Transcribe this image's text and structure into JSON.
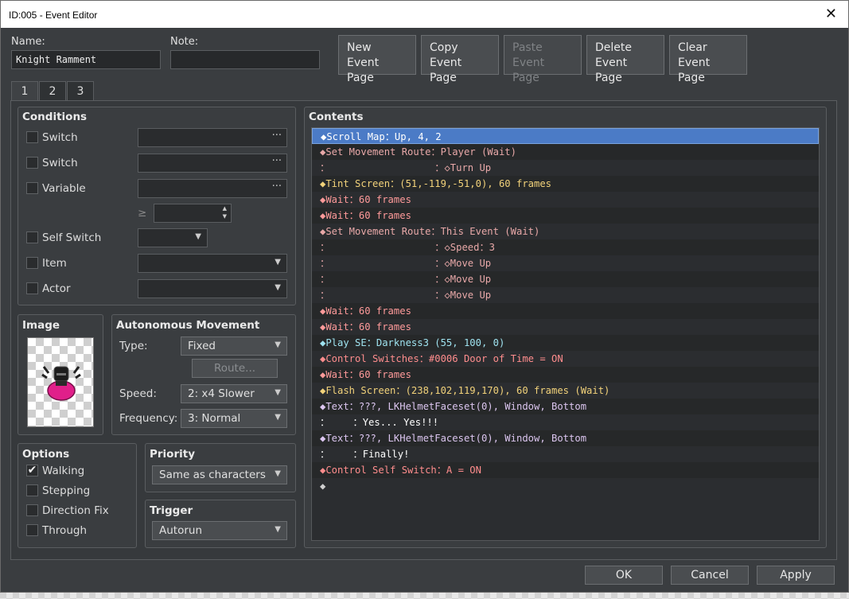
{
  "window": {
    "title": "ID:005 - Event Editor",
    "close_glyph": "✕"
  },
  "name": {
    "label": "Name:",
    "value": "Knight Ramment"
  },
  "note": {
    "label": "Note:",
    "value": ""
  },
  "page_buttons": [
    {
      "line1": "New",
      "line2": "Event Page",
      "enabled": true
    },
    {
      "line1": "Copy",
      "line2": "Event Page",
      "enabled": true
    },
    {
      "line1": "Paste",
      "line2": "Event Page",
      "enabled": false
    },
    {
      "line1": "Delete",
      "line2": "Event Page",
      "enabled": true
    },
    {
      "line1": "Clear",
      "line2": "Event Page",
      "enabled": true
    }
  ],
  "tabs": [
    "1",
    "2",
    "3"
  ],
  "conditions": {
    "title": "Conditions",
    "switch1": "Switch",
    "switch2": "Switch",
    "variable": "Variable",
    "ge_symbol": "≥",
    "self_switch": "Self Switch",
    "item": "Item",
    "actor": "Actor",
    "dots": "···"
  },
  "image": {
    "title": "Image"
  },
  "autonomous": {
    "title": "Autonomous Movement",
    "type_label": "Type:",
    "type_value": "Fixed",
    "route_label": "Route...",
    "speed_label": "Speed:",
    "speed_value": "2: x4 Slower",
    "frequency_label": "Frequency:",
    "frequency_value": "3: Normal"
  },
  "options": {
    "title": "Options",
    "walking": "Walking",
    "stepping": "Stepping",
    "direction_fix": "Direction Fix",
    "through": "Through",
    "check_glyph": "✔"
  },
  "priority": {
    "title": "Priority",
    "value": "Same as characters"
  },
  "trigger": {
    "title": "Trigger",
    "value": "Autorun"
  },
  "contents": {
    "title": "Contents",
    "rows": [
      {
        "text": "◆Scroll Map：Up, 4, 2",
        "cls": "c-scroll"
      },
      {
        "text": "◆Set Movement Route：Player (Wait)",
        "cls": "c-move"
      },
      {
        "text": "：                  ：◇Turn Up",
        "cls": "c-move"
      },
      {
        "text": "◆Tint Screen：(51,-119,-51,0), 60 frames",
        "cls": "c-tint"
      },
      {
        "text": "◆Wait：60 frames",
        "cls": "c-wait"
      },
      {
        "text": "◆Wait：60 frames",
        "cls": "c-wait"
      },
      {
        "text": "◆Set Movement Route：This Event (Wait)",
        "cls": "c-move"
      },
      {
        "text": "：                  ：◇Speed：3",
        "cls": "c-move"
      },
      {
        "text": "：                  ：◇Move Up",
        "cls": "c-move"
      },
      {
        "text": "：                  ：◇Move Up",
        "cls": "c-move"
      },
      {
        "text": "：                  ：◇Move Up",
        "cls": "c-move"
      },
      {
        "text": "◆Wait：60 frames",
        "cls": "c-wait"
      },
      {
        "text": "◆Wait：60 frames",
        "cls": "c-wait"
      },
      {
        "text": "◆Play SE：Darkness3 (55, 100, 0)",
        "cls": "c-se"
      },
      {
        "text": "◆Control Switches：#0006 Door of Time = ON",
        "cls": "c-sw"
      },
      {
        "text": "◆Wait：60 frames",
        "cls": "c-wait"
      },
      {
        "text": "◆Flash Screen：(238,102,119,170), 60 frames (Wait)",
        "cls": "c-tint"
      },
      {
        "text": "◆Text：???, LKHelmetFaceset(0), Window, Bottom",
        "cls": "c-text"
      },
      {
        "text": "：    ：Yes... Yes!!!",
        "cls": "c-bright"
      },
      {
        "text": "◆Text：???, LKHelmetFaceset(0), Window, Bottom",
        "cls": "c-text"
      },
      {
        "text": "：    ：Finally!",
        "cls": "c-bright"
      },
      {
        "text": "◆Control Self Switch：A = ON",
        "cls": "c-sw"
      },
      {
        "text": "◆",
        "cls": "c-grey"
      }
    ]
  },
  "footer": {
    "ok": "OK",
    "cancel": "Cancel",
    "apply": "Apply"
  },
  "colors": {
    "accent": "#4b7bc6",
    "panel": "#3a3d40"
  }
}
